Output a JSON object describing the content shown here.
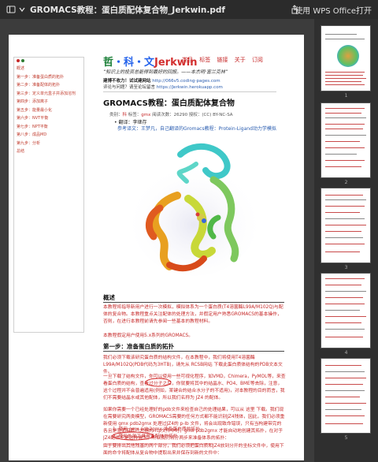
{
  "window": {
    "title": "GROMACS教程：蛋白质配体复合物_Jerkwin.pdf",
    "open_with": "使用 WPS Office打开"
  },
  "outline": {
    "items": [
      "概述",
      "第一步：准备蛋白质的拓扑",
      "第二步：准备配体的拓扑",
      "第三步：定义单元盒子并添加溶剂",
      "第四步：添加离子",
      "第五步：能量最小化",
      "第六步：NVT平衡",
      "第七步：NPT平衡",
      "第八步：成品MD",
      "第九步：分析",
      "总结"
    ]
  },
  "header": {
    "brand_1": "哲",
    "brand_2": "・科・文",
    "brand_3": "Jerkwin",
    "nav": [
      "类目",
      "标签",
      "链接",
      "关于",
      "订阅"
    ],
    "quote": "“知识上的投资总能得到最好的回报。——本杰明·富兰克林”",
    "site_label": "建博不收力！试试建网站",
    "site_url": "http://066v5.coding-pages.com",
    "comment_label": "评论与问题？请至论坛留言",
    "comment_url": "https://Jerkwin.herokuapp.com"
  },
  "doc": {
    "title": "GROMACS教程：蛋白质配体复合物",
    "meta_prefix": "类别：",
    "meta_category": "科",
    "meta_mid": " 标签：",
    "meta_tag": "gmx",
    "meta_rest": " 阅读次数：26290 授权：(CC) BY-NC-SA",
    "translator": "• 翻译：李继存",
    "reference": "参考译文：王梦凡，自己翻译的Gromacs教程：Protein-Ligand动力学模拟"
  },
  "sections": {
    "overview_title": "概述",
    "overview_p1": "本教程将指导新用户进行一次模拟，模拟体系为一个蛋白质(T4溶菌酶L99A/M102Q)与配体的复合物。本教程重点关注配体的处理方法，并假定用户熟悉GROMACS的基本操作，否则，在进行本教程前请先参阅一些基本的教程材料。",
    "overview_p2": "本教程假定用户使用5.x系列的GROMACS。",
    "step1_title": "第一步：准备蛋白质的拓扑",
    "step1_p1": "我们必须下载该研究蛋白质的结构文件，在本教程中，我们将使用T4溶菌酶L99A/M102Q(PDB代码为3HTB)，请先从 RCSB网站 下载此蛋白质体结构的PDB文本文件。",
    "step1_p2": "一旦下载了结构文件，你可以使用一些可视化程序，如VMD，Chimera，PyMOL等，来查看蛋白质的结构，查看过分子之后，你就要将其中的结晶水、PO4、BME等去除，注意，这个过程并不会普遍适用(例如，某键合的结合水分子的不适用)，对本教程的目的而言，我们不需要结晶水或其他配体，所以我们名称为 JZ4 的配体。",
    "step1_p3": "如果你需要一个已经处理好的pdb文件来检查自己的处理结果，可以从 这里 下载。我们现在需要研究两类模型，GROMACS需要的任何方式都不能识别JZ4残体，因此，我们必须重新使用 gmx pdb2gmx 处理过JZ4的 p-lb 文件，将会出现致命错误，只有当构建带完的各且是显而有其已方格的 rtp文件中时，gmx pdb2gmx 才能自动地创建其拓扑，在对于JZ4配体不是这种情况，所以我们将分两步来准备体系的拓扑：",
    "list_1": "1. 使用 gmx pdb2gmx 准备蛋白质的拓扑",
    "list_2": "2. 使用外部工具准备配体的拓扑",
    "step1_p4": "由于要排出其他残基的两个部分，我们必须把蛋白质和JZ4放到分开的坐标文件中，使用下面的命令将配体从复合物中提取出来并保存到新的文件中："
  },
  "sidebar": {
    "page_numbers": [
      "1",
      "2",
      "3",
      "4",
      "5"
    ]
  },
  "colors": {
    "accent_red": "#c62828",
    "link_blue": "#2a5db0",
    "brand_green": "#1a7f37",
    "titlebar_bg": "#2b2b2b"
  }
}
